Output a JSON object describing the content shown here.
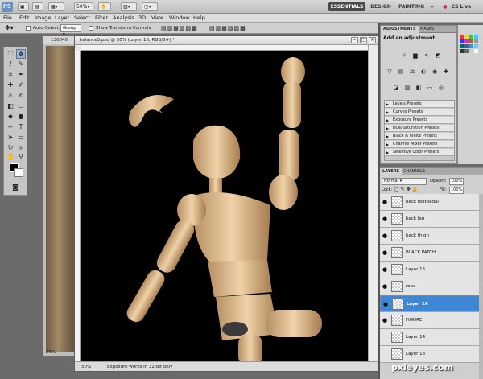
{
  "titlebar": {
    "logo": "PS",
    "zoom": "50%",
    "workspaces": [
      "ESSENTIALS",
      "DESIGN",
      "PAINTING"
    ],
    "more": "»",
    "cslive": "CS Live"
  },
  "menu": [
    "File",
    "Edit",
    "Image",
    "Layer",
    "Select",
    "Filter",
    "Analysis",
    "3D",
    "View",
    "Window",
    "Help"
  ],
  "options": {
    "auto_select": "Auto-Select:",
    "auto_select_value": "Group",
    "show_transform": "Show Transform Controls"
  },
  "back_document": {
    "tab": "130840",
    "zoom": "25%"
  },
  "document": {
    "tab": "balance3.psd @ 50% (Layer 16, RGB/8#) *",
    "zoom": "50%",
    "status": "Exposure works in 32-bit only"
  },
  "adjustments": {
    "tabs": [
      "ADJUSTMENTS",
      "MASKS"
    ],
    "title": "Add an adjustment",
    "presets": [
      "Levels Presets",
      "Curves Presets",
      "Exposure Presets",
      "Hue/Saturation Presets",
      "Black & White Presets",
      "Channel Mixer Presets",
      "Selective Color Presets"
    ]
  },
  "layers": {
    "tabs": [
      "LAYERS",
      "CHANNELS"
    ],
    "blend_mode": "Normal",
    "opacity_label": "Opacity:",
    "opacity": "100%",
    "lock_label": "Lock:",
    "fill_label": "Fill:",
    "fill": "100%",
    "items": [
      {
        "name": "back footpedal",
        "visible": true
      },
      {
        "name": "back leg",
        "visible": true
      },
      {
        "name": "back thigh",
        "visible": true
      },
      {
        "name": "BLACK PATCH",
        "visible": true
      },
      {
        "name": "Layer 15",
        "visible": true
      },
      {
        "name": "rope",
        "visible": true
      },
      {
        "name": "Layer 16",
        "visible": true,
        "selected": true
      },
      {
        "name": "FIGURE",
        "visible": true
      },
      {
        "name": "Layer 14",
        "visible": false
      },
      {
        "name": "Layer 13",
        "visible": false
      }
    ]
  },
  "watermark": "pxleyes.com"
}
